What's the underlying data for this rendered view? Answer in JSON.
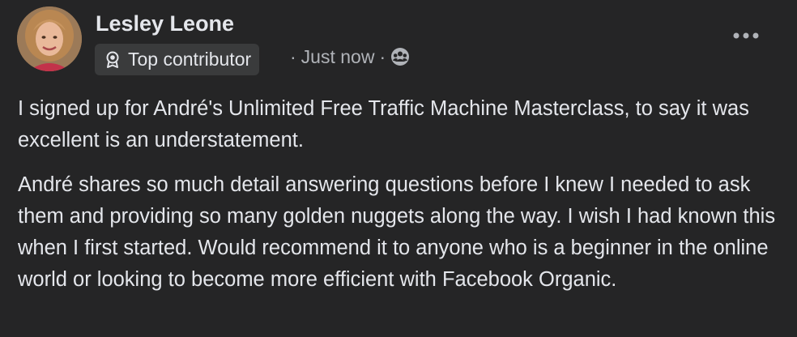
{
  "post": {
    "author": {
      "name": "Lesley Leone",
      "avatar_icon": "profile-photo",
      "badge": {
        "icon": "award-ribbon-icon",
        "label": "Top contributor"
      }
    },
    "meta": {
      "separator": "·",
      "timestamp": "Just now",
      "audience_icon": "group-members-icon"
    },
    "more_icon": "more-options-icon",
    "paragraphs": [
      "I signed up for André's Unlimited Free Traffic Machine Masterclass, to say it was excellent is an understatement.",
      "André shares so much detail answering questions before I knew I needed to ask them and providing so many golden nuggets along the way. I wish I had known this when I first started. Would recommend it to anyone who is a beginner in the online world or looking to become more efficient with Facebook Organic."
    ]
  },
  "colors": {
    "background": "#252526",
    "text_primary": "#e4e6eb",
    "text_secondary": "#b0b3b8",
    "badge_background": "#3a3b3c"
  }
}
